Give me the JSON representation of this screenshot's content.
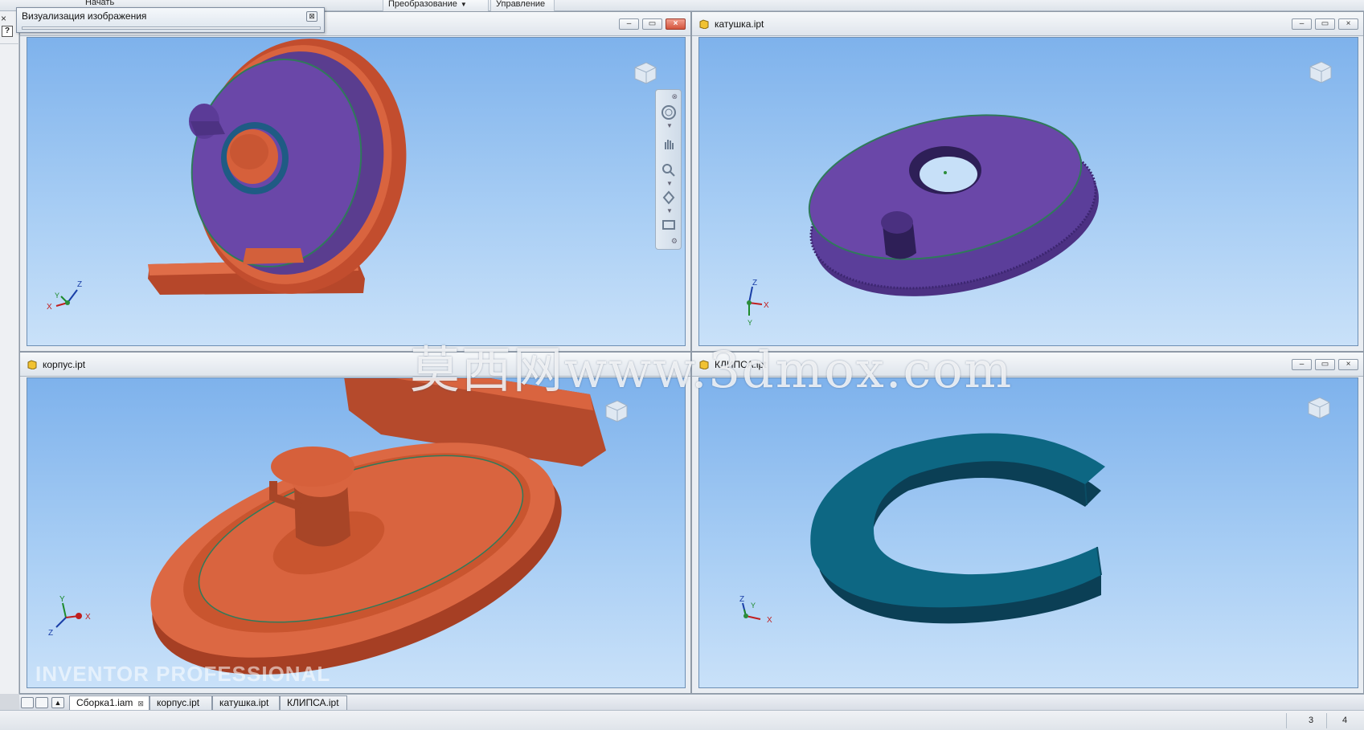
{
  "ribbon": {
    "start_label": "Начать",
    "transform_tab": "Преобразование",
    "manage_tab": "Управление"
  },
  "left_strip": {
    "close_glyph": "×",
    "help_glyph": "?"
  },
  "panel": {
    "title": "Визуализация изображения",
    "close_glyph": "⊠"
  },
  "viewports": {
    "assembly": {
      "title": ""
    },
    "spool": {
      "title": "катушка.ipt"
    },
    "body": {
      "title": "корпус.ipt"
    },
    "clip": {
      "title": "КЛИПСА.ipt"
    }
  },
  "window_controls": {
    "minimize": "–",
    "restore": "▭",
    "close": "×"
  },
  "axes": {
    "x": "X",
    "y": "Y",
    "z": "Z"
  },
  "document_tabs": [
    {
      "label": "Сборка1.iam",
      "active": true,
      "closable": true
    },
    {
      "label": "корпус.ipt",
      "active": false,
      "closable": false
    },
    {
      "label": "катушка.ipt",
      "active": false,
      "closable": false
    },
    {
      "label": "КЛИПСА.ipt",
      "active": false,
      "closable": false
    }
  ],
  "status": {
    "count_a": "3",
    "count_b": "4"
  },
  "watermark": "莫西网www.3dmox.com",
  "brand_text": "INVENTOR PROFESSIONAL",
  "icons": [
    "help-icon",
    "document-icon",
    "orbit-icon",
    "pan-icon",
    "zoom-icon",
    "look-at-icon",
    "viewcube-icon"
  ],
  "colors": {
    "sky_top": "#7eb2ec",
    "part_orange": "#d8623f",
    "part_purple": "#6a47a8",
    "part_teal": "#0d6783"
  }
}
